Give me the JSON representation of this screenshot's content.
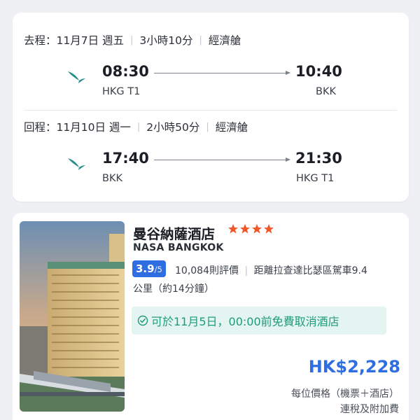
{
  "outbound": {
    "label": "去程：11月7日 週五",
    "duration": "3小時10分",
    "cabin": "經濟艙",
    "depart_time": "08:30",
    "depart_airport": "HKG T1",
    "arrive_time": "10:40",
    "arrive_airport": "BKK"
  },
  "inbound": {
    "label": "回程：11月10日 週一",
    "duration": "2小時50分",
    "cabin": "經濟艙",
    "depart_time": "17:40",
    "depart_airport": "BKK",
    "arrive_time": "21:30",
    "arrive_airport": "HKG T1"
  },
  "hotel": {
    "name": "曼谷納薩酒店",
    "star_rating": 4,
    "english_name": "NASA BANGKOK",
    "score": "3.9",
    "score_max": "/5",
    "reviews": "10,084則評價",
    "distance_1": "距離拉查達比瑟區駕車9.4",
    "distance_2": "公里（約14分鐘）",
    "cancellation": "可於11月5日，00:00前免費取消酒店",
    "price": "HK$2,228",
    "price_note": "每位價格（機票＋酒店）",
    "tax_note": "連稅及附加費"
  },
  "colors": {
    "accent_blue": "#2f6ee0",
    "star_orange": "#f0582a",
    "airline_teal": "#2b8c8c",
    "cancel_green": "#1f9a7a"
  },
  "icons": {
    "airline": "cathay-pacific-brushwing-icon",
    "star": "star-icon",
    "check": "check-circle-icon"
  }
}
